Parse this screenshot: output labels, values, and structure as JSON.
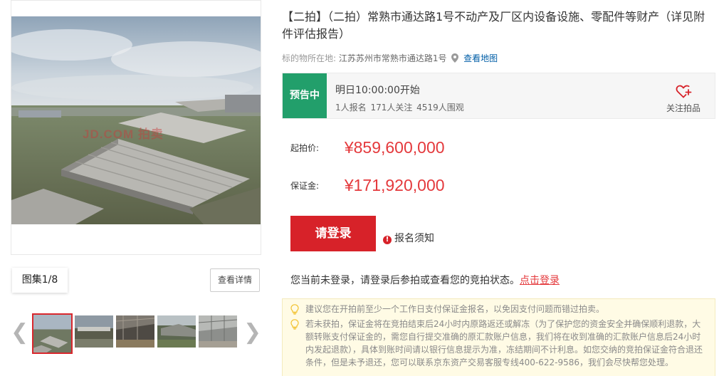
{
  "gallery": {
    "watermark": "JD.COM 拍卖",
    "count_label": "图集1/8",
    "detail_button": "查看详情",
    "prev_arrow": "❮",
    "next_arrow": "❯"
  },
  "auction": {
    "title": "【二拍】（二拍）常熟市通达路1号不动产及厂区内设备设施、零配件等财产（详见附件评估报告）",
    "location_label": "标的物所在地:",
    "location_value": "江苏苏州市常熟市通达路1号",
    "map_link": "查看地图"
  },
  "status": {
    "badge": "预告中",
    "time": "明日10:00:00开始",
    "stats": "1人报名 171人关注 4519人围观",
    "follow_label": "关注拍品"
  },
  "prices": {
    "start_label": "起拍价:",
    "start_value": "¥859,600,000",
    "deposit_label": "保证金:",
    "deposit_value": "¥171,920,000"
  },
  "actions": {
    "login_button": "请登录",
    "notice_link": "报名须知",
    "notice_icon": "!",
    "login_tip": "您当前未登录，请登录后参拍或查看您的竞拍状态。",
    "login_link": "点击登录"
  },
  "tips": [
    "建议您在开拍前至少一个工作日支付保证金报名，以免因支付问题而错过拍卖。",
    "若未获拍，保证金将在竞拍结束后24小时内原路返还或解冻（为了保护您的资金安全并确保顺利退款，大额转账支付保证金的，需您自行提交准确的原汇款账户信息，我们将在收到准确的汇款账户信息后24小时内发起退款），具体到账时间请以银行信息提示为准，冻结期间不计利息。如您交纳的竞拍保证金符合退还条件，但是未予退还，您可以联系京东资产交易客服专线400-622-9586，我们会尽快帮您处理。"
  ],
  "colors": {
    "accent_red": "#d72229",
    "price_red": "#e4393c",
    "status_green": "#229f6b",
    "link_blue": "#005ea7"
  }
}
